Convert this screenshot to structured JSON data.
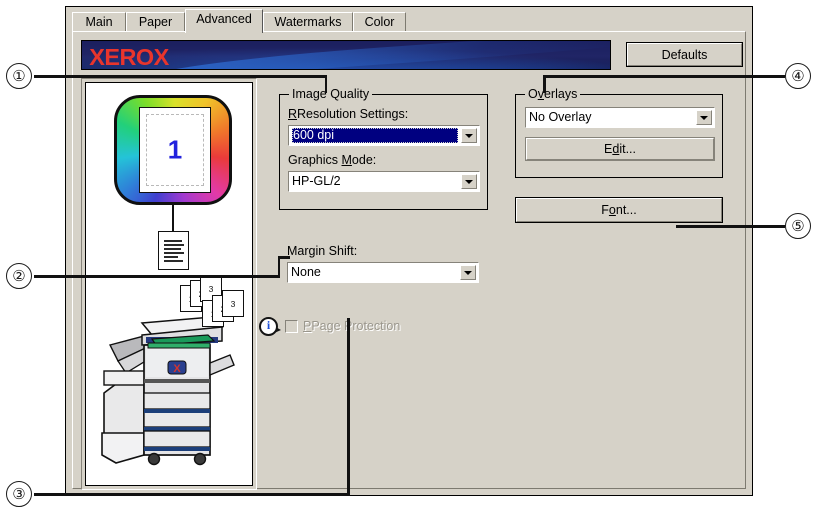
{
  "dialog": {
    "tabs": [
      {
        "label": "Main",
        "active": false
      },
      {
        "label": "Paper",
        "active": false
      },
      {
        "label": "Advanced",
        "active": true
      },
      {
        "label": "Watermarks",
        "active": false
      },
      {
        "label": "Color",
        "active": false
      }
    ],
    "brand": "XEROX",
    "defaults_button": "Defaults"
  },
  "preview": {
    "page_number": "1",
    "output_pages": [
      "1",
      "2",
      "3",
      "1",
      "2",
      "3"
    ]
  },
  "image_quality": {
    "group_label": "Image Quality",
    "resolution_label": "Resolution Settings:",
    "resolution_value": "600 dpi",
    "graphics_label": "Graphics Mode:",
    "graphics_value": "HP-GL/2"
  },
  "margin_shift": {
    "label": "Margin Shift:",
    "value": "None"
  },
  "page_protection": {
    "label": "Page Protection",
    "checked": false,
    "enabled": false
  },
  "overlays": {
    "group_label": "Overlays",
    "value": "No Overlay",
    "edit_button": "Edit..."
  },
  "font_button": "Font...",
  "callouts": [
    {
      "number": "①"
    },
    {
      "number": "②"
    },
    {
      "number": "③"
    },
    {
      "number": "④"
    },
    {
      "number": "⑤"
    }
  ],
  "colors": {
    "dialog_face": "#d6d2c8",
    "banner_navy": "#1b1f5e",
    "brand_red": "#e8352c",
    "selection_navy": "#000080",
    "disabled_gray": "#9a968c"
  }
}
